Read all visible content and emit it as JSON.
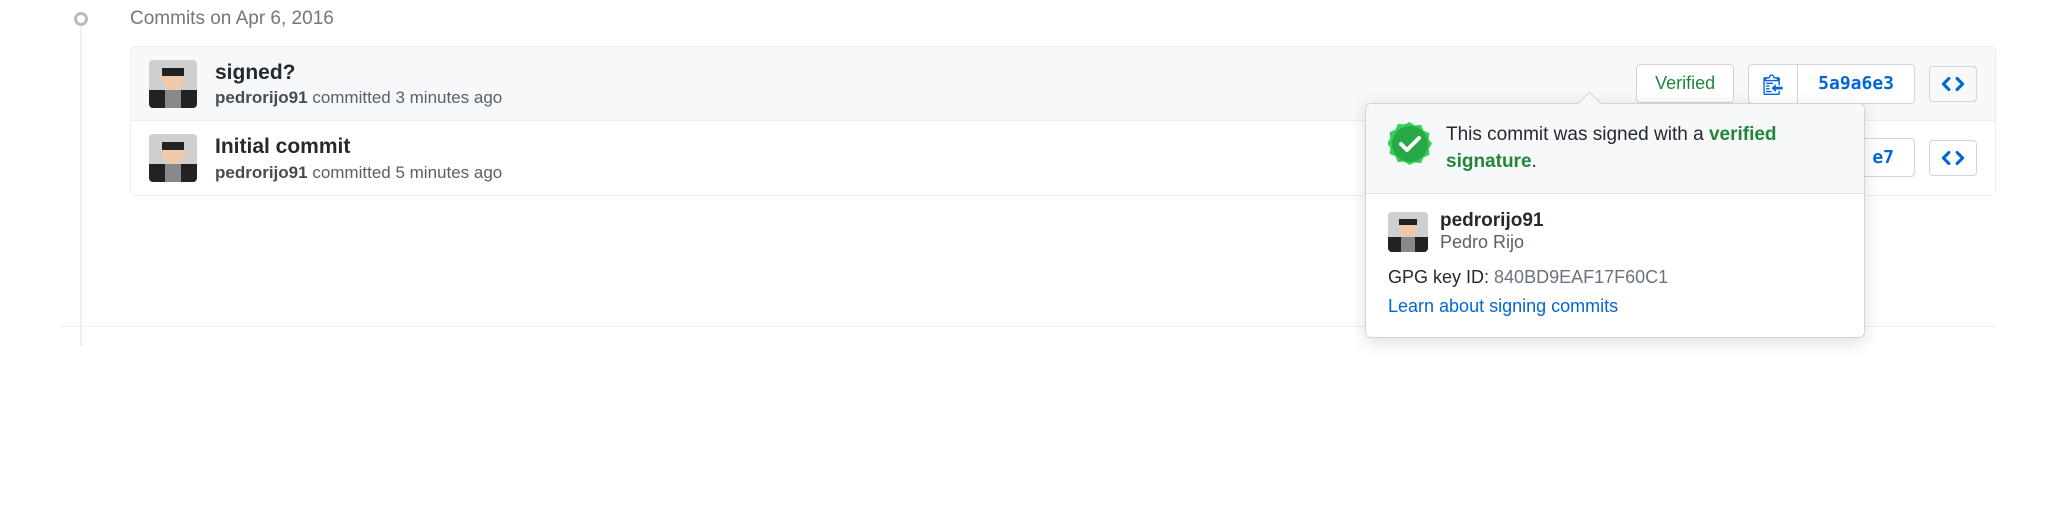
{
  "date_header": "Commits on Apr 6, 2016",
  "commits": [
    {
      "title": "signed?",
      "author": "pedrorijo91",
      "meta_rest": " committed 3 minutes ago",
      "verified_label": "Verified",
      "sha": "5a9a6e3"
    },
    {
      "title": "Initial commit",
      "author": "pedrorijo91",
      "meta_rest": " committed 5 minutes ago",
      "sha_partial": "e7"
    }
  ],
  "popover": {
    "line1": "This commit was signed with a",
    "verified_signature": "verified signature",
    "period": ".",
    "username": "pedrorijo91",
    "fullname": "Pedro Rijo",
    "gpg_label": "GPG key ID: ",
    "gpg_key": "840BD9EAF17F60C1",
    "learn": "Learn about signing commits"
  }
}
